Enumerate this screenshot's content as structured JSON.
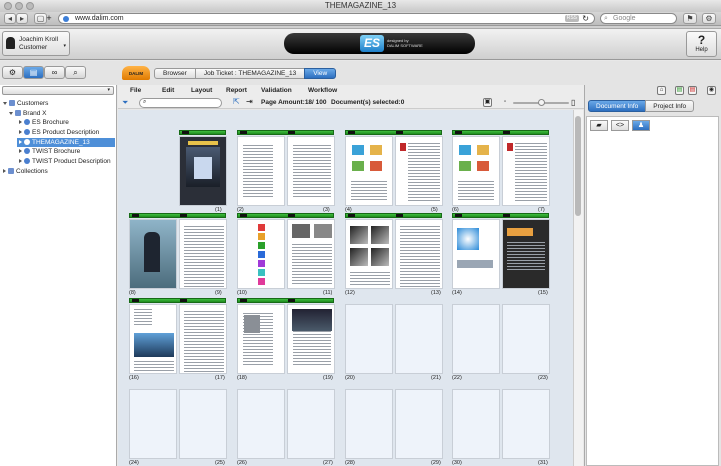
{
  "window": {
    "title": "THEMAGAZINE_13"
  },
  "browser": {
    "url": "www.dalim.com",
    "rss_label": "RSS",
    "search_placeholder": "Google"
  },
  "user": {
    "name": "Joachim Kroll",
    "role": "Customer"
  },
  "logo": {
    "mark": "ES",
    "line1": "designed by",
    "line2": "DALIM SOFTWARE"
  },
  "help": {
    "label": "Help"
  },
  "brand_logo": "DALIM",
  "breadcrumb": [
    {
      "label": "Browser"
    },
    {
      "label": "Job Ticket : THEMAGAZINE_13"
    },
    {
      "label": "View"
    }
  ],
  "tree": {
    "items": [
      {
        "label": "Customers"
      },
      {
        "label": "Brand X"
      },
      {
        "label": "ES Brochure"
      },
      {
        "label": "ES Product Description"
      },
      {
        "label": "THEMAGAZINE_13"
      },
      {
        "label": "TWIST Brochure"
      },
      {
        "label": "TWIST Product Description"
      },
      {
        "label": "Collections"
      }
    ]
  },
  "menu": [
    "File",
    "Edit",
    "Layout",
    "Report",
    "Validation",
    "Workflow"
  ],
  "status": {
    "page_amount": "Page Amount:18/ 100",
    "selected": "Document(s) selected:0"
  },
  "right_tabs": [
    "Document Info",
    "Project Info"
  ],
  "page_numbers": [
    "(1)",
    "(2)",
    "(3)",
    "(4)",
    "(5)",
    "(6)",
    "(7)",
    "(8)",
    "(9)",
    "(10)",
    "(11)",
    "(12)",
    "(13)",
    "(14)",
    "(15)",
    "(16)",
    "(17)",
    "(18)",
    "(19)",
    "(20)",
    "(21)",
    "(22)",
    "(23)",
    "(24)",
    "(25)",
    "(26)",
    "(27)",
    "(28)",
    "(29)",
    "(30)",
    "(31)"
  ],
  "colors": {
    "accent": "#2d6fc0",
    "approved": "#2aa52a",
    "selected": "#4e8fd8"
  }
}
